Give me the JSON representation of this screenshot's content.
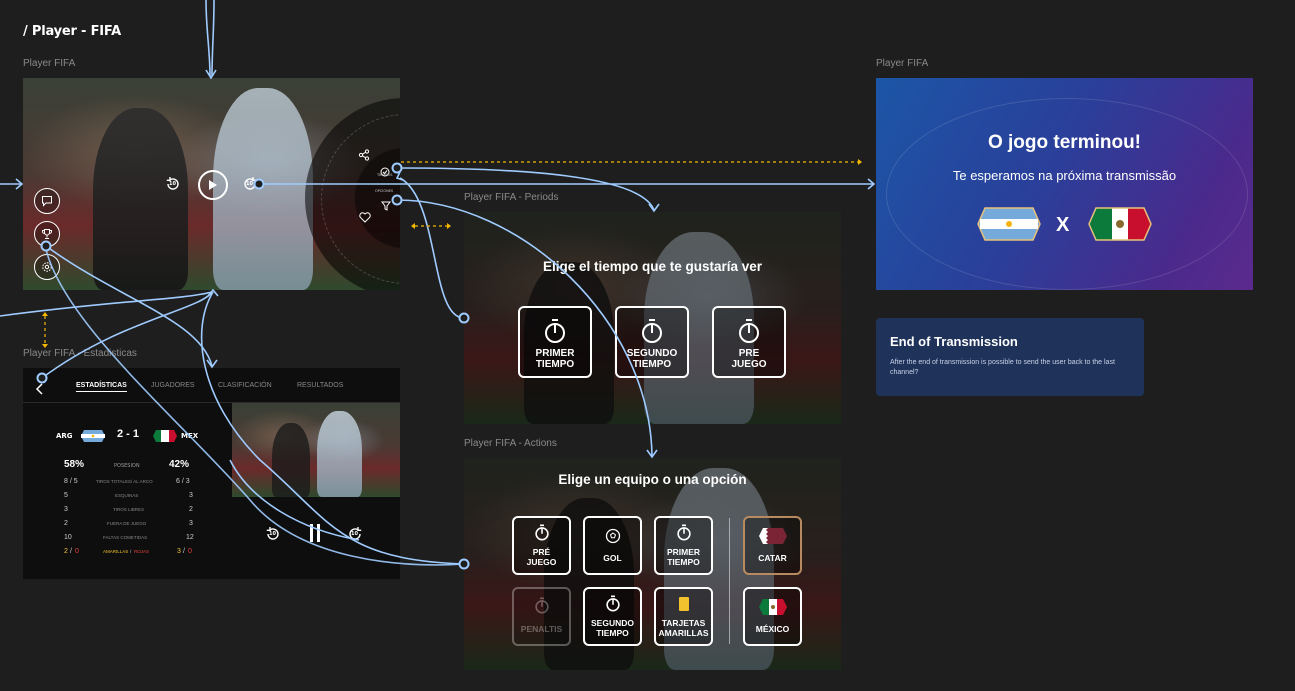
{
  "page_title": "/ Player - FIFA",
  "labels": {
    "player": "Player FIFA",
    "periods": "Player FIFA - Periods",
    "actions": "Player FIFA - Actions",
    "stats": "Player FIFA - Estadisticas",
    "end": "Player FIFA"
  },
  "player": {
    "menu_time": "TIEMPOS",
    "menu_options": "OPCIONES",
    "skip_back": "10",
    "skip_fwd": "10"
  },
  "periods": {
    "heading": "Elige el tiempo que te gustaría ver",
    "options": [
      {
        "line1": "PRIMER",
        "line2": "TIEMPO"
      },
      {
        "line1": "SEGUNDO",
        "line2": "TIEMPO"
      },
      {
        "line1": "PRE",
        "line2": "JUEGO"
      }
    ]
  },
  "actions": {
    "heading": "Elige un equipo o una opción",
    "options": [
      {
        "line1": "PRÉ",
        "line2": "JUEGO"
      },
      {
        "line1": "GOL",
        "line2": ""
      },
      {
        "line1": "PRIMER",
        "line2": "TIEMPO"
      },
      {
        "line1": "PENALTIS",
        "line2": ""
      },
      {
        "line1": "SEGUNDO",
        "line2": "TIEMPO"
      },
      {
        "line1": "TARJETAS",
        "line2": "AMARILLAS"
      }
    ],
    "teams": [
      {
        "name": "CATAR",
        "color": "#7a2436"
      },
      {
        "name": "MÉXICO",
        "color": "#0b7a3b"
      }
    ]
  },
  "stats": {
    "tabs": [
      "ESTADÍSTICAS",
      "JUGADORES",
      "CLASIFICACIÓN",
      "RESULTADOS"
    ],
    "home": "ARG",
    "away": "MEX",
    "score": "2 - 1",
    "possession_home": "58%",
    "possession_away": "42%",
    "possession_label": "POSESION",
    "rows": [
      {
        "home": "8 / 5",
        "label": "TIROS TOTALES/ AL ARCO",
        "away": "6 / 3"
      },
      {
        "home": "5",
        "label": "ESQUINAS",
        "away": "3"
      },
      {
        "home": "3",
        "label": "TIROS LIBRES",
        "away": "2"
      },
      {
        "home": "2",
        "label": "FUERA DE JUEGO",
        "away": "3"
      },
      {
        "home": "10",
        "label": "FALTAS COMETIDAS",
        "away": "12"
      }
    ],
    "cards_home_yellow": "2",
    "cards_home_red": "0",
    "cards_label_yellow": "AMARILLAS",
    "cards_label_red": "ROJAS",
    "cards_away_yellow": "3",
    "cards_away_red": "0",
    "skip_back": "10",
    "skip_fwd": "10"
  },
  "end": {
    "title": "O jogo terminou!",
    "subtitle": "Te esperamos na próxima transmissão",
    "vs": "X"
  },
  "note": {
    "title": "End of Transmission",
    "body": "After the end of transmission is possible to send the user back to the last channel?"
  },
  "colors": {
    "connector": "#9fcbff",
    "accent_dashed": "#f5b800",
    "note_bg": "#1f3259"
  }
}
